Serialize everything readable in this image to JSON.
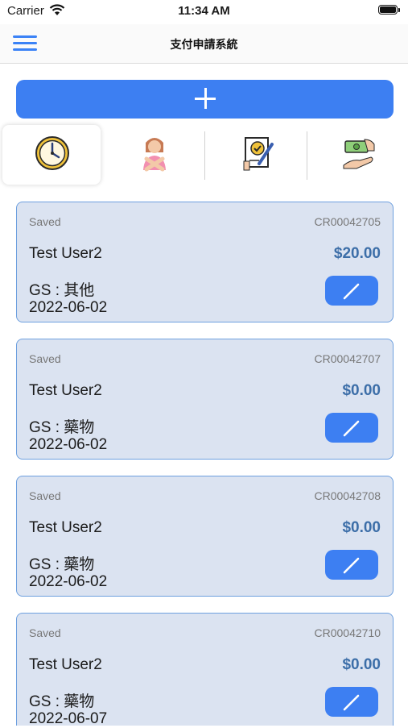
{
  "status_bar": {
    "carrier": "Carrier",
    "time": "11:34 AM"
  },
  "nav": {
    "title": "支付申請系統"
  },
  "tabs": [
    {
      "icon": "clock-icon",
      "active": true
    },
    {
      "icon": "person-crossed-arms-icon",
      "active": false
    },
    {
      "icon": "document-approval-icon",
      "active": false
    },
    {
      "icon": "money-hand-icon",
      "active": false
    }
  ],
  "colors": {
    "accent": "#3d7ff2",
    "card_bg": "#dbe3f1",
    "card_border": "#6ea0df",
    "amount": "#3c6ea8"
  },
  "requests": [
    {
      "status": "Saved",
      "code": "CR00042705",
      "user": "Test User2",
      "amount": "$20.00",
      "category": "GS : 其他",
      "date": "2022-06-02"
    },
    {
      "status": "Saved",
      "code": "CR00042707",
      "user": "Test User2",
      "amount": "$0.00",
      "category": "GS : 藥物",
      "date": "2022-06-02"
    },
    {
      "status": "Saved",
      "code": "CR00042708",
      "user": "Test User2",
      "amount": "$0.00",
      "category": "GS : 藥物",
      "date": "2022-06-02"
    },
    {
      "status": "Saved",
      "code": "CR00042710",
      "user": "Test User2",
      "amount": "$0.00",
      "category": "GS : 藥物",
      "date": "2022-06-07"
    }
  ]
}
